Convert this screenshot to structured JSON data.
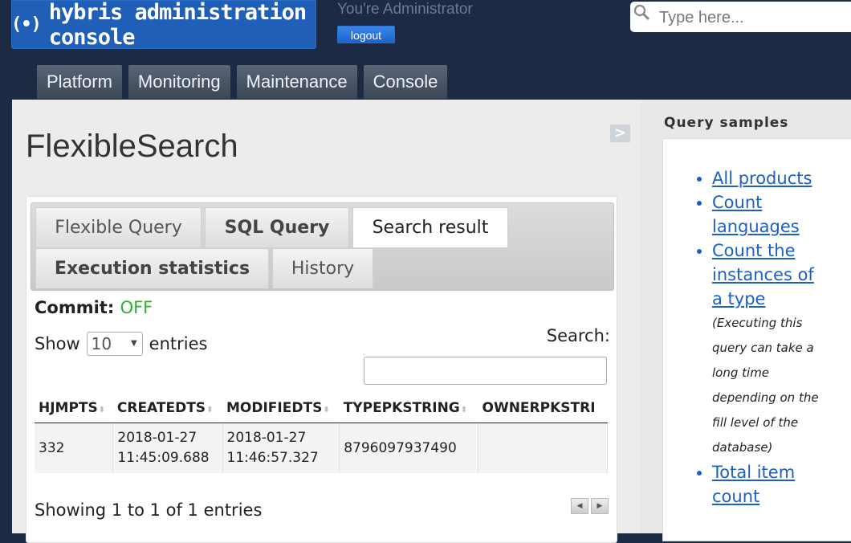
{
  "header": {
    "logo_text": "hybris administration console",
    "user_text": "You're Administrator",
    "logout_label": "logout",
    "search_placeholder": "Type here..."
  },
  "nav": {
    "tabs": [
      "Platform",
      "Monitoring",
      "Maintenance",
      "Console"
    ]
  },
  "main": {
    "title": "FlexibleSearch",
    "toggle_label": ">",
    "tabs": [
      "Flexible Query",
      "SQL Query",
      "Search result",
      "Execution statistics",
      "History"
    ],
    "active_tab": "Search result",
    "commit_label": "Commit:",
    "commit_value": "OFF",
    "show_label": "Show",
    "entries_label": "entries",
    "page_size": "10",
    "search_label": "Search:",
    "table": {
      "columns": [
        "HJMPTS",
        "CREATEDTS",
        "MODIFIEDTS",
        "TYPEPKSTRING",
        "OWNERPKSTRI"
      ],
      "rows": [
        [
          "332",
          "2018-01-27\n11:45:09.688",
          "2018-01-27\n11:46:57.327",
          "8796097937490",
          ""
        ]
      ]
    },
    "showing_text": "Showing 1 to 1 of 1 entries"
  },
  "sidebar": {
    "title": "Query samples",
    "items": [
      {
        "label": "All products"
      },
      {
        "label": "Count languages"
      },
      {
        "label": "Count the instances of a type ",
        "note": "(Executing this query can take a long time depending on the fill level of the database)"
      },
      {
        "label": "Total item count"
      }
    ]
  },
  "colors": {
    "header_bg": "#1c2a44",
    "logo_bg": "#1f5fb8",
    "commit_off": "#2bb32b",
    "link": "#1d5fc4"
  }
}
